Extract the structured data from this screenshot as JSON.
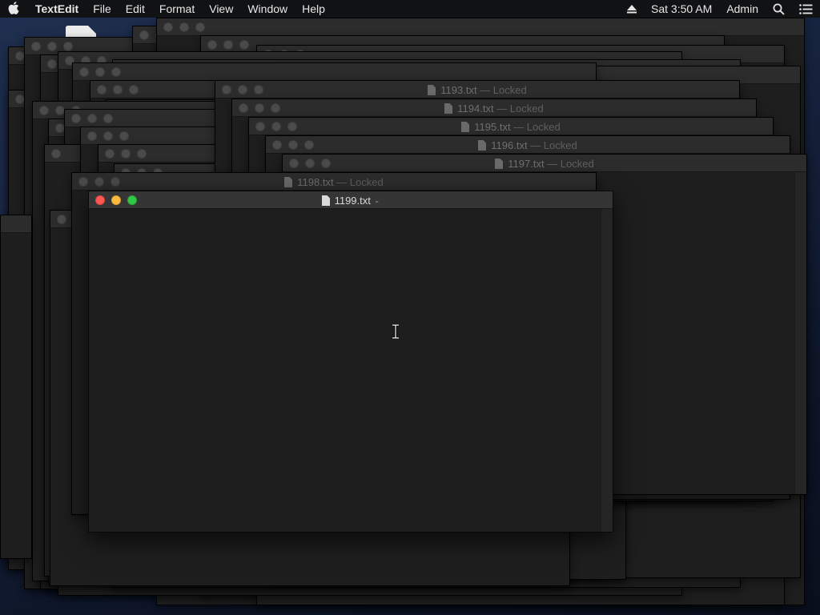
{
  "menubar": {
    "app_name": "TextEdit",
    "menus": [
      "File",
      "Edit",
      "Format",
      "View",
      "Window",
      "Help"
    ],
    "clock": "Sat 3:50 AM",
    "user": "Admin"
  },
  "windows": {
    "w1193": {
      "name": "1193.txt",
      "status": "— Locked"
    },
    "w1194": {
      "name": "1194.txt",
      "status": "— Locked"
    },
    "w1195": {
      "name": "1195.txt",
      "status": "— Locked"
    },
    "w1196": {
      "name": "1196.txt",
      "status": "— Locked"
    },
    "w1197": {
      "name": "1197.txt",
      "status": "— Locked"
    },
    "w1198": {
      "name": "1198.txt",
      "status": "— Locked"
    }
  },
  "front_window": {
    "name": "1199.txt",
    "chevron": "⌄",
    "traffic_light_colors": {
      "close": "#fc5753",
      "minimize": "#fdbc40",
      "maximize": "#33c748"
    }
  },
  "icons": {
    "apple": "apple-logo-icon",
    "eject": "eject-icon",
    "search": "spotlight-search-icon",
    "notifications": "notification-center-icon",
    "document": "document-icon",
    "cursor": "text-cursor-ibeam-icon"
  }
}
